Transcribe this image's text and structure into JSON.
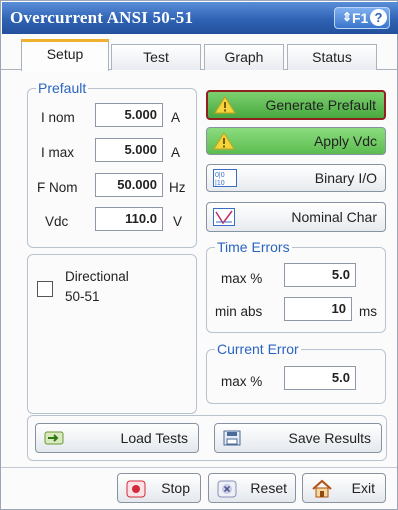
{
  "window": {
    "title": "Overcurrent ANSI 50-51",
    "help_label": "F1",
    "help_arrows": "⇕",
    "help_q": "?"
  },
  "tabs": [
    {
      "label": "Setup",
      "active": true
    },
    {
      "label": "Test",
      "active": false
    },
    {
      "label": "Graph",
      "active": false
    },
    {
      "label": "Status",
      "active": false
    }
  ],
  "prefault": {
    "title": "Prefault",
    "fields": [
      {
        "label": "I nom",
        "value": "5.000",
        "unit": "A"
      },
      {
        "label": "I max",
        "value": "5.000",
        "unit": "A"
      },
      {
        "label": "F Nom",
        "value": "50.000",
        "unit": "Hz"
      },
      {
        "label": "Vdc",
        "value": "110.0",
        "unit": "V"
      }
    ]
  },
  "directional": {
    "label_line1": "Directional",
    "label_line2": "50-51",
    "checked": false
  },
  "actions": {
    "generate_prefault": "Generate Prefault",
    "apply_vdc": "Apply Vdc",
    "binary_io": "Binary I/O",
    "nominal_char": "Nominal Char"
  },
  "time_errors": {
    "title": "Time Errors",
    "max_pct_label": "max %",
    "max_pct_value": "5.0",
    "min_abs_label": "min abs",
    "min_abs_value": "10",
    "min_abs_unit": "ms"
  },
  "current_error": {
    "title": "Current Error",
    "max_pct_label": "max %",
    "max_pct_value": "5.0"
  },
  "file_buttons": {
    "load_tests": "Load Tests",
    "save_results": "Save Results"
  },
  "footer": {
    "stop": "Stop",
    "reset": "Reset",
    "exit": "Exit"
  },
  "colors": {
    "title_bar": "#2f62b4",
    "accent_green": "#5cbc50",
    "group_title": "#2a64c0",
    "stop_red": "#d22a3a"
  }
}
